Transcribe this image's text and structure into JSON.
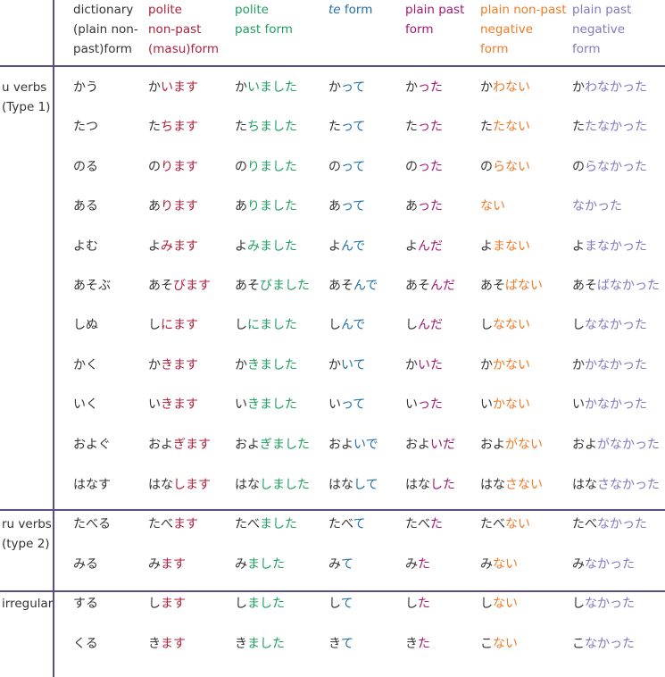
{
  "colors": {
    "plain_text": "#333333",
    "dictionary": "#333333",
    "polite_nonpast": "#b01f3a",
    "polite_past": "#20a060",
    "te_form": "#1e6ea8",
    "plain_past": "#a3186f",
    "plain_nonpast_negative": "#f07a28",
    "plain_past_negative": "#8578c0",
    "rule_line": "#5b4e86"
  },
  "headers": {
    "dictionary": "dictionary\n(plain non-\npast)form",
    "polite_nonpast": "polite\nnon-past\n(masu)form",
    "polite_past": "polite\npast form",
    "te_form_italic": "te",
    "te_form_rest": " form",
    "plain_past": "plain past\nform",
    "plain_nonpast_negative": "plain non-past\nnegative\nform",
    "plain_past_negative": "plain past\nnegative\nform"
  },
  "groups": [
    {
      "label": "u verbs\n(Type 1)"
    },
    {
      "label": "ru verbs\n(type 2)"
    },
    {
      "label": "irregular"
    }
  ],
  "rows": [
    {
      "dict": "かう",
      "pnp": [
        "か",
        "います"
      ],
      "pp": [
        "か",
        "いました"
      ],
      "te": [
        "か",
        "って"
      ],
      "plp": [
        "か",
        "った"
      ],
      "pnn": [
        "か",
        "わない"
      ],
      "pn": [
        "か",
        "わなかった"
      ]
    },
    {
      "dict": "たつ",
      "pnp": [
        "た",
        "ちます"
      ],
      "pp": [
        "た",
        "ちました"
      ],
      "te": [
        "た",
        "って"
      ],
      "plp": [
        "た",
        "った"
      ],
      "pnn": [
        "た",
        "たない"
      ],
      "pn": [
        "た",
        "たなかった"
      ]
    },
    {
      "dict": "のる",
      "pnp": [
        "の",
        "ります"
      ],
      "pp": [
        "の",
        "りました"
      ],
      "te": [
        "の",
        "って"
      ],
      "plp": [
        "の",
        "った"
      ],
      "pnn": [
        "の",
        "らない"
      ],
      "pn": [
        "の",
        "らなかった"
      ]
    },
    {
      "dict": "ある",
      "pnp": [
        "あ",
        "ります"
      ],
      "pp": [
        "あ",
        "りました"
      ],
      "te": [
        "あ",
        "って"
      ],
      "plp": [
        "あ",
        "った"
      ],
      "pnn": [
        "",
        "ない"
      ],
      "pn": [
        "",
        "なかった"
      ]
    },
    {
      "dict": "よむ",
      "pnp": [
        "よ",
        "みます"
      ],
      "pp": [
        "よ",
        "みました"
      ],
      "te": [
        "よ",
        "んで"
      ],
      "plp": [
        "よ",
        "んだ"
      ],
      "pnn": [
        "よ",
        "まない"
      ],
      "pn": [
        "よ",
        "まなかった"
      ]
    },
    {
      "dict": "あそぶ",
      "pnp": [
        "あそ",
        "びます"
      ],
      "pp": [
        "あそ",
        "びました"
      ],
      "te": [
        "あそ",
        "んで"
      ],
      "plp": [
        "あそ",
        "んだ"
      ],
      "pnn": [
        "あそ",
        "ばない"
      ],
      "pn": [
        "あそ",
        "ばなかった"
      ]
    },
    {
      "dict": "しぬ",
      "pnp": [
        "し",
        "にます"
      ],
      "pp": [
        "し",
        "にました"
      ],
      "te": [
        "し",
        "んで"
      ],
      "plp": [
        "し",
        "んだ"
      ],
      "pnn": [
        "し",
        "なない"
      ],
      "pn": [
        "し",
        "ななかった"
      ]
    },
    {
      "dict": "かく",
      "pnp": [
        "か",
        "きます"
      ],
      "pp": [
        "か",
        "きました"
      ],
      "te": [
        "か",
        "いて"
      ],
      "plp": [
        "か",
        "いた"
      ],
      "pnn": [
        "か",
        "かない"
      ],
      "pn": [
        "か",
        "かなかった"
      ]
    },
    {
      "dict": "いく",
      "pnp": [
        "い",
        "きます"
      ],
      "pp": [
        "い",
        "きました"
      ],
      "te": [
        "い",
        "って"
      ],
      "plp": [
        "い",
        "った"
      ],
      "pnn": [
        "い",
        "かない"
      ],
      "pn": [
        "い",
        "かなかった"
      ]
    },
    {
      "dict": "およぐ",
      "pnp": [
        "およ",
        "ぎます"
      ],
      "pp": [
        "およ",
        "ぎました"
      ],
      "te": [
        "およ",
        "いで"
      ],
      "plp": [
        "およ",
        "いだ"
      ],
      "pnn": [
        "およ",
        "がない"
      ],
      "pn": [
        "およ",
        "がなかった"
      ]
    },
    {
      "dict": "はなす",
      "pnp": [
        "はな",
        "します"
      ],
      "pp": [
        "はな",
        "しました"
      ],
      "te": [
        "はな",
        "して"
      ],
      "plp": [
        "はな",
        "した"
      ],
      "pnn": [
        "はな",
        "さない"
      ],
      "pn": [
        "はな",
        "さなかった"
      ]
    },
    {
      "dict": "たべる",
      "pnp": [
        "たべ",
        "ます"
      ],
      "pp": [
        "たべ",
        "ました"
      ],
      "te": [
        "たべ",
        "て"
      ],
      "plp": [
        "たべ",
        "た"
      ],
      "pnn": [
        "たべ",
        "ない"
      ],
      "pn": [
        "たべ",
        "なかった"
      ]
    },
    {
      "dict": "みる",
      "pnp": [
        "み",
        "ます"
      ],
      "pp": [
        "み",
        "ました"
      ],
      "te": [
        "み",
        "て"
      ],
      "plp": [
        "み",
        "た"
      ],
      "pnn": [
        "み",
        "ない"
      ],
      "pn": [
        "み",
        "なかった"
      ]
    },
    {
      "dict": "する",
      "pnp": [
        "し",
        "ます"
      ],
      "pp": [
        "し",
        "ました"
      ],
      "te": [
        "し",
        "て"
      ],
      "plp": [
        "し",
        "た"
      ],
      "pnn": [
        "し",
        "ない"
      ],
      "pn": [
        "し",
        "なかった"
      ]
    },
    {
      "dict": "くる",
      "pnp": [
        "き",
        "ます"
      ],
      "pp": [
        "き",
        "ました"
      ],
      "te": [
        "き",
        "て"
      ],
      "plp": [
        "き",
        "た"
      ],
      "pnn": [
        "こ",
        "ない"
      ],
      "pn": [
        "こ",
        "なかった"
      ]
    }
  ]
}
